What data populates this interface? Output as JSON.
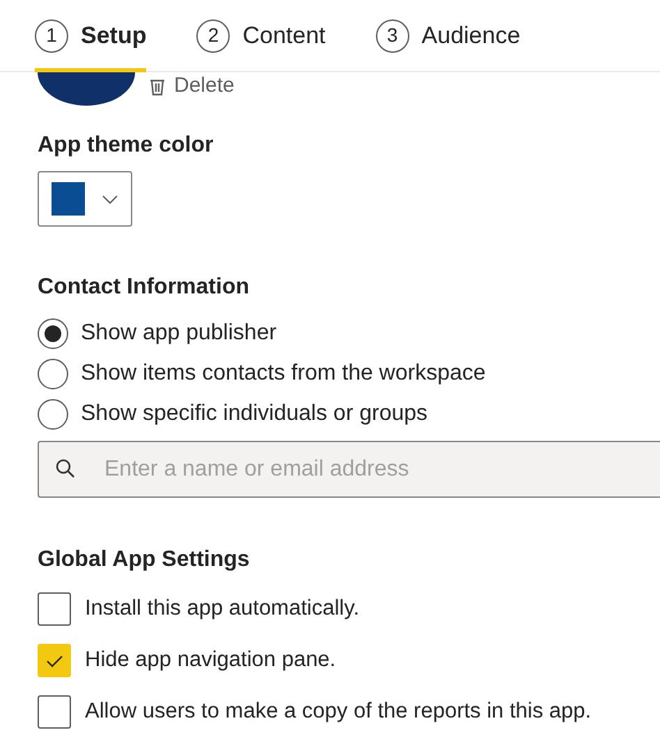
{
  "steps": [
    {
      "number": "1",
      "label": "Setup",
      "selected": true
    },
    {
      "number": "2",
      "label": "Content",
      "selected": false
    },
    {
      "number": "3",
      "label": "Audience",
      "selected": false
    }
  ],
  "logo": {
    "delete_label": "Delete"
  },
  "theme": {
    "label": "App theme color",
    "color": "#0b4d93"
  },
  "contact": {
    "title": "Contact Information",
    "options": [
      {
        "label": "Show app publisher",
        "selected": true
      },
      {
        "label": "Show items contacts from the workspace",
        "selected": false
      },
      {
        "label": "Show specific individuals or groups",
        "selected": false
      }
    ],
    "search": {
      "placeholder": "Enter a name or email address"
    }
  },
  "global": {
    "title": "Global App Settings",
    "options": [
      {
        "label": "Install this app automatically.",
        "checked": false
      },
      {
        "label": "Hide app navigation pane.",
        "checked": true
      },
      {
        "label": "Allow users to make a copy of the reports in this app.",
        "checked": false
      }
    ]
  }
}
